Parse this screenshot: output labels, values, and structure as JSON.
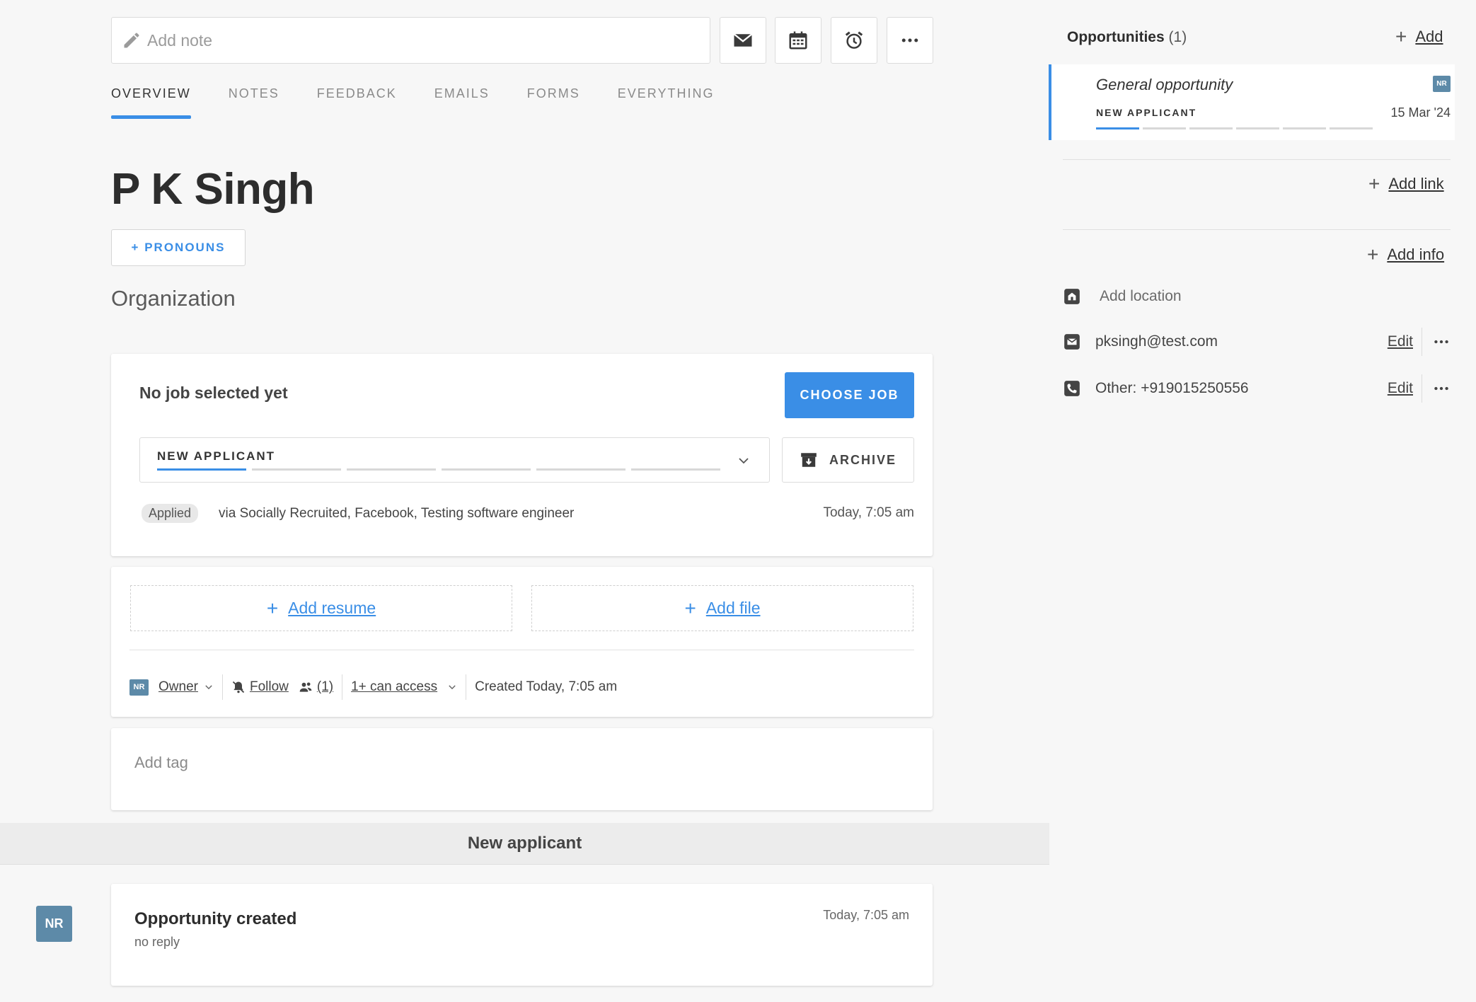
{
  "toolbar": {
    "note_placeholder": "Add note",
    "icons": [
      "email-icon",
      "calendar-icon",
      "alarm-icon",
      "more-icon"
    ]
  },
  "tabs": [
    {
      "label": "OVERVIEW",
      "active": true
    },
    {
      "label": "NOTES",
      "active": false
    },
    {
      "label": "FEEDBACK",
      "active": false
    },
    {
      "label": "EMAILS",
      "active": false
    },
    {
      "label": "FORMS",
      "active": false
    },
    {
      "label": "EVERYTHING",
      "active": false
    }
  ],
  "profile": {
    "name": "P K Singh",
    "pronouns_button": "+ PRONOUNS",
    "organization": "Organization"
  },
  "job": {
    "title": "No job selected yet",
    "choose_job_label": "CHOOSE JOB",
    "stage_label": "NEW APPLICANT",
    "archive_label": "ARCHIVE",
    "applied_badge": "Applied",
    "source_text": "via Socially Recruited, Facebook, Testing software engineer",
    "applied_time": "Today, 7:05 am"
  },
  "files": {
    "add_resume": "Add resume",
    "add_file": "Add file",
    "owner_avatar": "NR",
    "owner_label": "Owner",
    "follow_label": "Follow",
    "followers_count": "(1)",
    "access_label": "1+ can access",
    "created_text": "Created Today, 7:05 am"
  },
  "tags": {
    "placeholder": "Add tag"
  },
  "timeline": {
    "stage_header": "New applicant",
    "avatar": "NR",
    "event_title": "Opportunity created",
    "event_sub": "no reply",
    "event_time": "Today, 7:05 am"
  },
  "sidebar": {
    "opportunities_label": "Opportunities",
    "opportunities_count": "(1)",
    "add_label": "Add",
    "opportunity": {
      "title": "General opportunity",
      "stage": "NEW APPLICANT",
      "avatar": "NR",
      "date": "15 Mar '24"
    },
    "add_link_label": "Add link",
    "add_info_label": "Add info",
    "location_placeholder": "Add location",
    "email": "pksingh@test.com",
    "phone": "Other: +919015250556",
    "edit_label": "Edit"
  },
  "colors": {
    "accent": "#3a8ee6",
    "avatar_bg": "#5d8aa8",
    "page_bg": "#f7f7f7"
  }
}
